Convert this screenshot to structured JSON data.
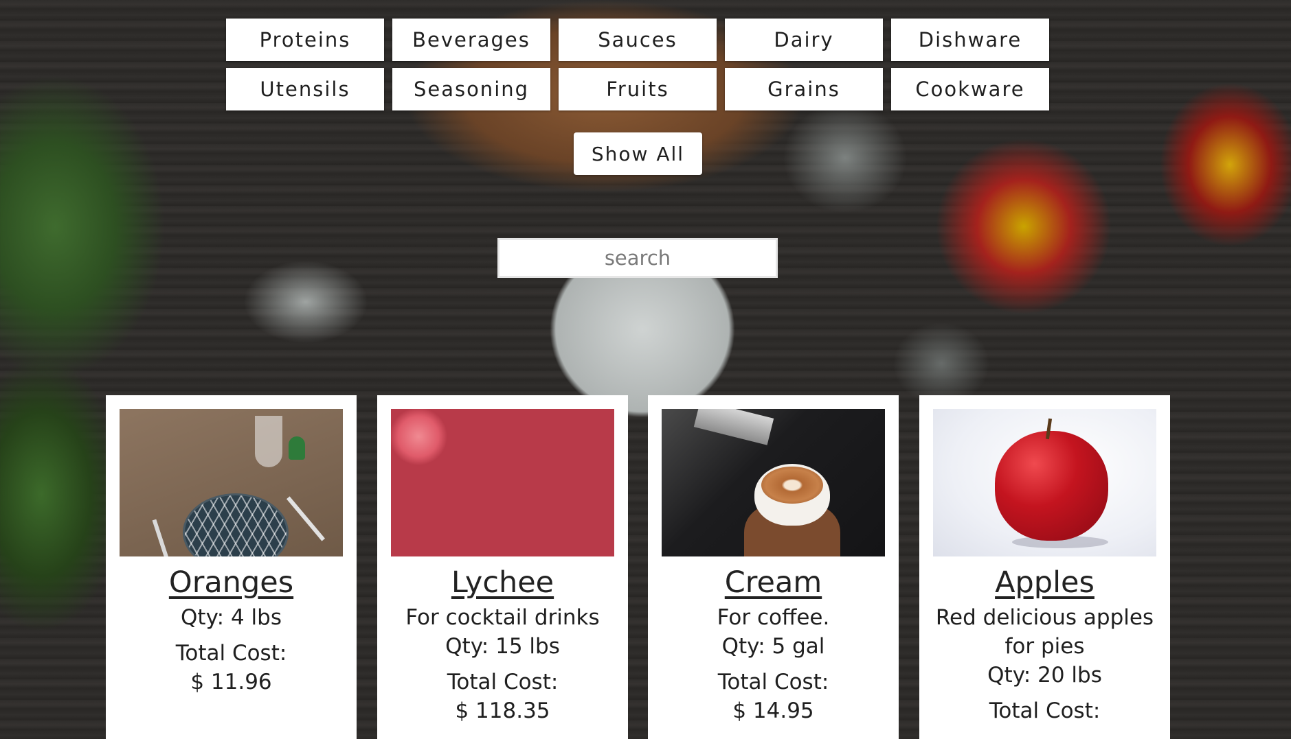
{
  "categories": [
    "Proteins",
    "Beverages",
    "Sauces",
    "Dairy",
    "Dishware",
    "Utensils",
    "Seasoning",
    "Fruits",
    "Grains",
    "Cookware"
  ],
  "show_all_label": "Show All",
  "search": {
    "placeholder": "search",
    "value": ""
  },
  "cards": [
    {
      "title": "Oranges",
      "description": "",
      "qty": "Qty: 4 lbs",
      "total_label": "Total Cost:",
      "total_value": "$ 11.96",
      "photo": "plate-on-table-image"
    },
    {
      "title": "Lychee",
      "description": "For cocktail drinks",
      "qty": "Qty: 15 lbs",
      "total_label": "Total Cost:",
      "total_value": "$ 118.35",
      "photo": "lychee-image"
    },
    {
      "title": "Cream",
      "description": "For coffee.",
      "qty": "Qty: 5 gal",
      "total_label": "Total Cost:",
      "total_value": "$ 14.95",
      "photo": "latte-image"
    },
    {
      "title": "Apples",
      "description": "Red delicious apples for pies",
      "qty": "Qty: 20 lbs",
      "total_label": "Total Cost:",
      "total_value": "",
      "photo": "apple-image"
    }
  ]
}
